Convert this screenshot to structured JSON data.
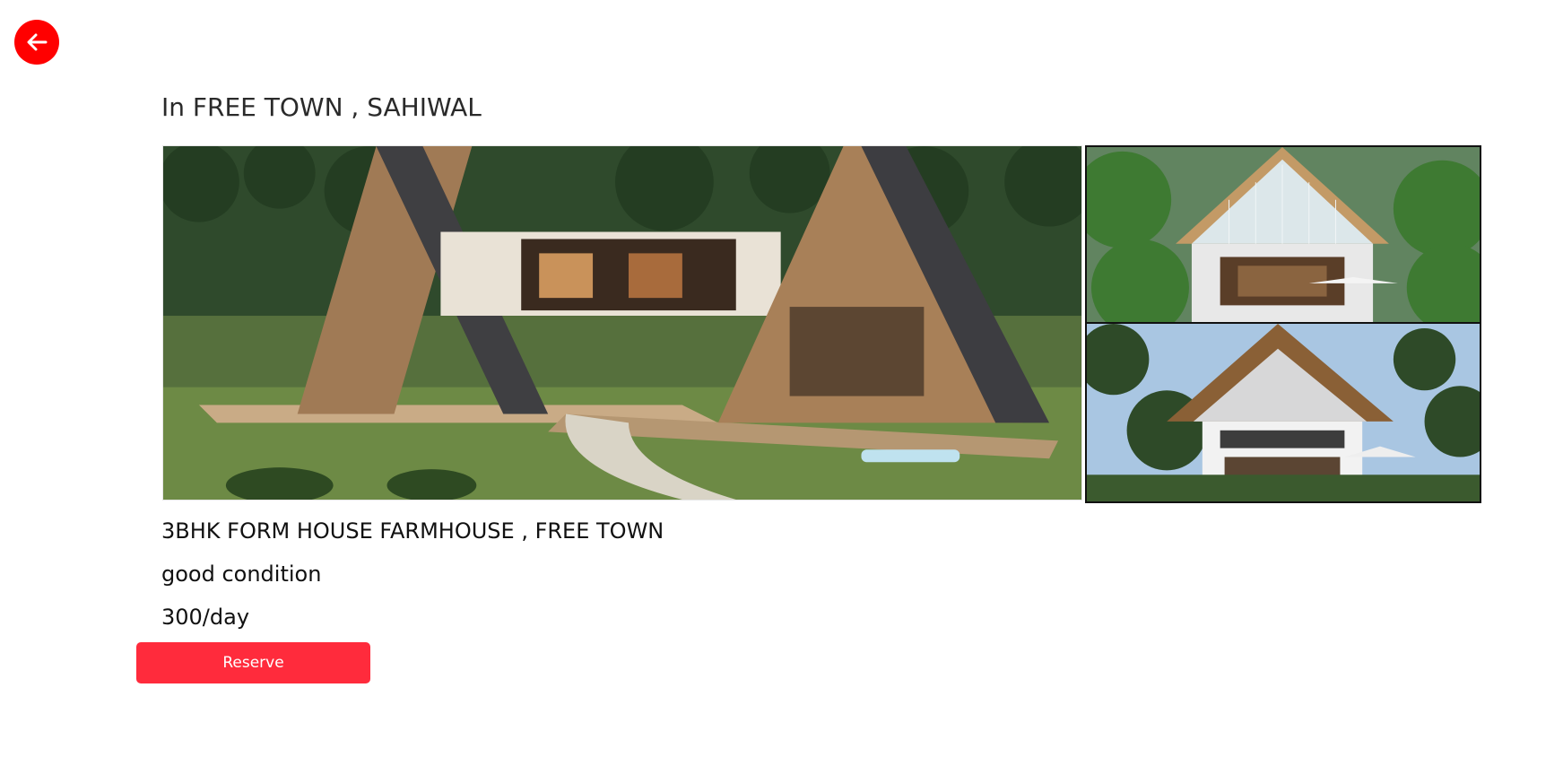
{
  "header": {
    "back_icon": "arrow-left-icon",
    "location_title": "In FREE TOWN , SAHIWAL"
  },
  "gallery": {
    "images": [
      {
        "alt": "A-frame farmhouse with lawn"
      },
      {
        "alt": "Glass-front villa among tropical plants"
      },
      {
        "alt": "Thatched roof villa under palm trees"
      }
    ]
  },
  "listing": {
    "title": "3BHK FORM HOUSE FARMHOUSE , FREE TOWN",
    "condition": "good condition",
    "price": "300/day"
  },
  "actions": {
    "reserve_label": "Reserve"
  },
  "colors": {
    "back_button": "#ff0000",
    "reserve_button": "#ff2b3c"
  }
}
